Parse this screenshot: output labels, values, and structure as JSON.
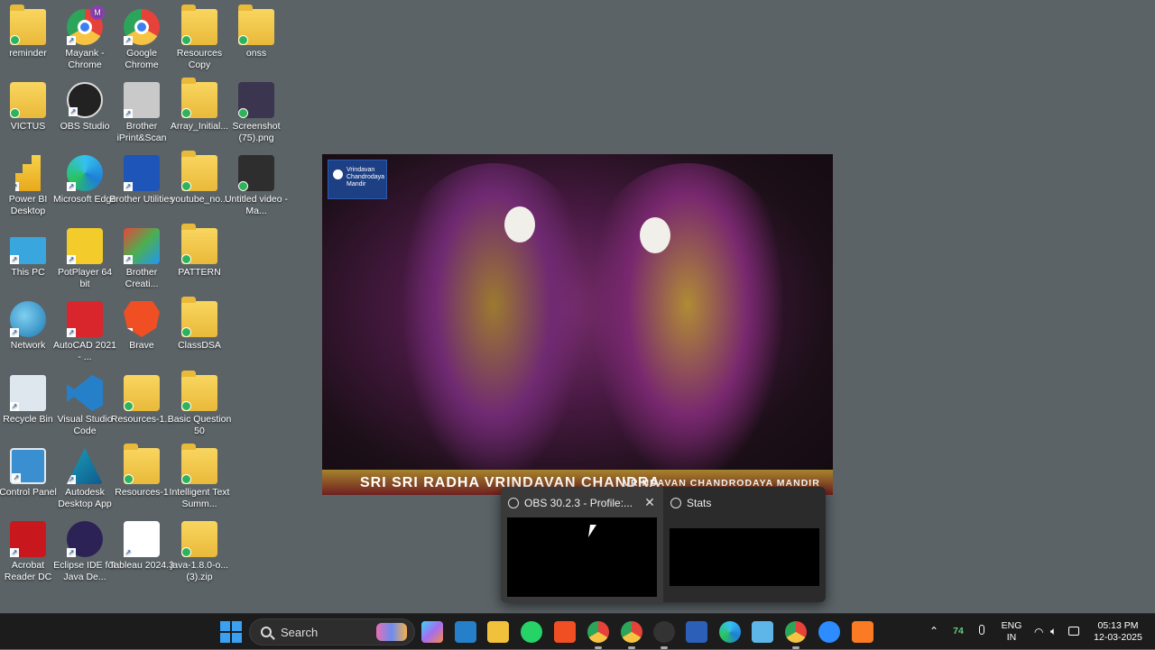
{
  "desktop": {
    "columns": [
      [
        {
          "label": "reminder",
          "icon": "folder-icon"
        },
        {
          "label": "VICTUS",
          "icon": "user-folder-icon"
        },
        {
          "label": "Power BI Desktop",
          "icon": "powerbi-icon"
        },
        {
          "label": "This PC",
          "icon": "computer-icon"
        },
        {
          "label": "Network",
          "icon": "network-icon"
        },
        {
          "label": "Recycle Bin",
          "icon": "recycle-bin-icon"
        },
        {
          "label": "Control Panel",
          "icon": "control-panel-icon"
        },
        {
          "label": "Acrobat Reader DC",
          "icon": "acrobat-icon"
        }
      ],
      [
        {
          "label": "Mayank - Chrome",
          "icon": "chrome-icon"
        },
        {
          "label": "OBS Studio",
          "icon": "obs-icon"
        },
        {
          "label": "Microsoft Edge",
          "icon": "edge-icon"
        },
        {
          "label": "PotPlayer 64 bit",
          "icon": "potplayer-icon"
        },
        {
          "label": "AutoCAD 2021 - ...",
          "icon": "autocad-icon"
        },
        {
          "label": "Visual Studio Code",
          "icon": "vscode-icon"
        },
        {
          "label": "Autodesk Desktop App",
          "icon": "autodesk-icon"
        },
        {
          "label": "Eclipse IDE for Java De...",
          "icon": "eclipse-icon"
        }
      ],
      [
        {
          "label": "Google Chrome",
          "icon": "chrome-icon"
        },
        {
          "label": "Brother iPrint&Scan",
          "icon": "printer-icon"
        },
        {
          "label": "Brother Utilities",
          "icon": "brother-utilities-icon"
        },
        {
          "label": "Brother Creati...",
          "icon": "brother-creative-icon"
        },
        {
          "label": "Brave",
          "icon": "brave-icon"
        },
        {
          "label": "Resources-1...",
          "icon": "zip-folder-icon"
        },
        {
          "label": "Resources-1",
          "icon": "folder-icon"
        },
        {
          "label": "Tableau 2024.3",
          "icon": "tableau-icon"
        }
      ],
      [
        {
          "label": "Resources Copy",
          "icon": "folder-icon"
        },
        {
          "label": "Array_Initial...",
          "icon": "folder-icon"
        },
        {
          "label": "youtube_no...",
          "icon": "folder-icon"
        },
        {
          "label": "PATTERN",
          "icon": "folder-icon"
        },
        {
          "label": "ClassDSA",
          "icon": "folder-icon"
        },
        {
          "label": "Basic Question 50",
          "icon": "folder-icon"
        },
        {
          "label": "Intelligent Text Summ...",
          "icon": "folder-icon"
        },
        {
          "label": "java-1.8.0-o... (3).zip",
          "icon": "zip-folder-icon"
        }
      ],
      [
        {
          "label": "onss",
          "icon": "folder-icon"
        },
        {
          "label": "Screenshot (75).png",
          "icon": "image-file-icon"
        },
        {
          "label": "Untitled video - Ma...",
          "icon": "video-file-icon"
        }
      ]
    ],
    "chrome_profile_letter": "M"
  },
  "photo": {
    "logo_text": "Vrindavan Chandrodaya Mandir",
    "banner_main": "SRI SRI RADHA VRINDAVAN CHANDRA",
    "banner_sub": "VRINDAVAN CHANDRODAYA MANDIR"
  },
  "thumbnails": [
    {
      "title": "OBS 30.2.3 - Profile:...",
      "close": "✕"
    },
    {
      "title": "Stats"
    }
  ],
  "taskbar": {
    "search_label": "Search",
    "apps": [
      "copilot-icon",
      "vscode-icon",
      "file-explorer-icon",
      "whatsapp-icon",
      "brave-icon",
      "chrome-icon",
      "chrome-profile-icon",
      "obs-icon",
      "word-icon",
      "edge-icon",
      "notepad-icon",
      "chrome-icon",
      "zoom-icon",
      "xampp-icon"
    ],
    "tray": {
      "battery_level": "74",
      "lang_top": "ENG",
      "lang_bottom": "IN",
      "time": "05:13 PM",
      "date": "12-03-2025"
    }
  },
  "colors": {
    "desktop_bg": "#5b6367",
    "taskbar_bg": "#1c1c1c",
    "accent": "#3aa1f2"
  }
}
